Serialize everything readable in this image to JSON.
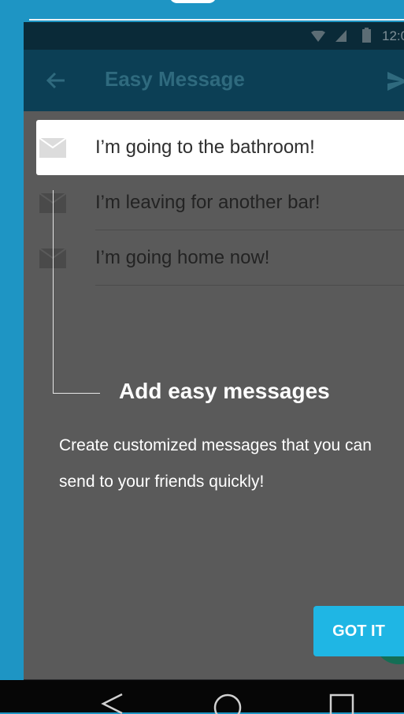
{
  "status_bar": {
    "time": "12:0"
  },
  "app_bar": {
    "title": "Easy Message"
  },
  "messages": [
    {
      "text": "I’m going to the bathroom!"
    },
    {
      "text": "I’m leaving for another bar!"
    },
    {
      "text": "I’m going home now!"
    }
  ],
  "tip": {
    "title": "Add easy messages",
    "body": "Create customized messages that you can send to your friends quickly!"
  },
  "got_it_button": "GOT IT",
  "colors": {
    "background": "#1e95c4",
    "app_bar": "#0c3f55",
    "accent_button": "#1fb6e4",
    "overlay": "#5a5a5a"
  },
  "icons": [
    "wifi-icon",
    "signal-icon",
    "battery-icon",
    "back-arrow-icon",
    "send-icon",
    "mail-icon",
    "nav-back-icon",
    "nav-home-icon",
    "nav-recents-icon"
  ]
}
